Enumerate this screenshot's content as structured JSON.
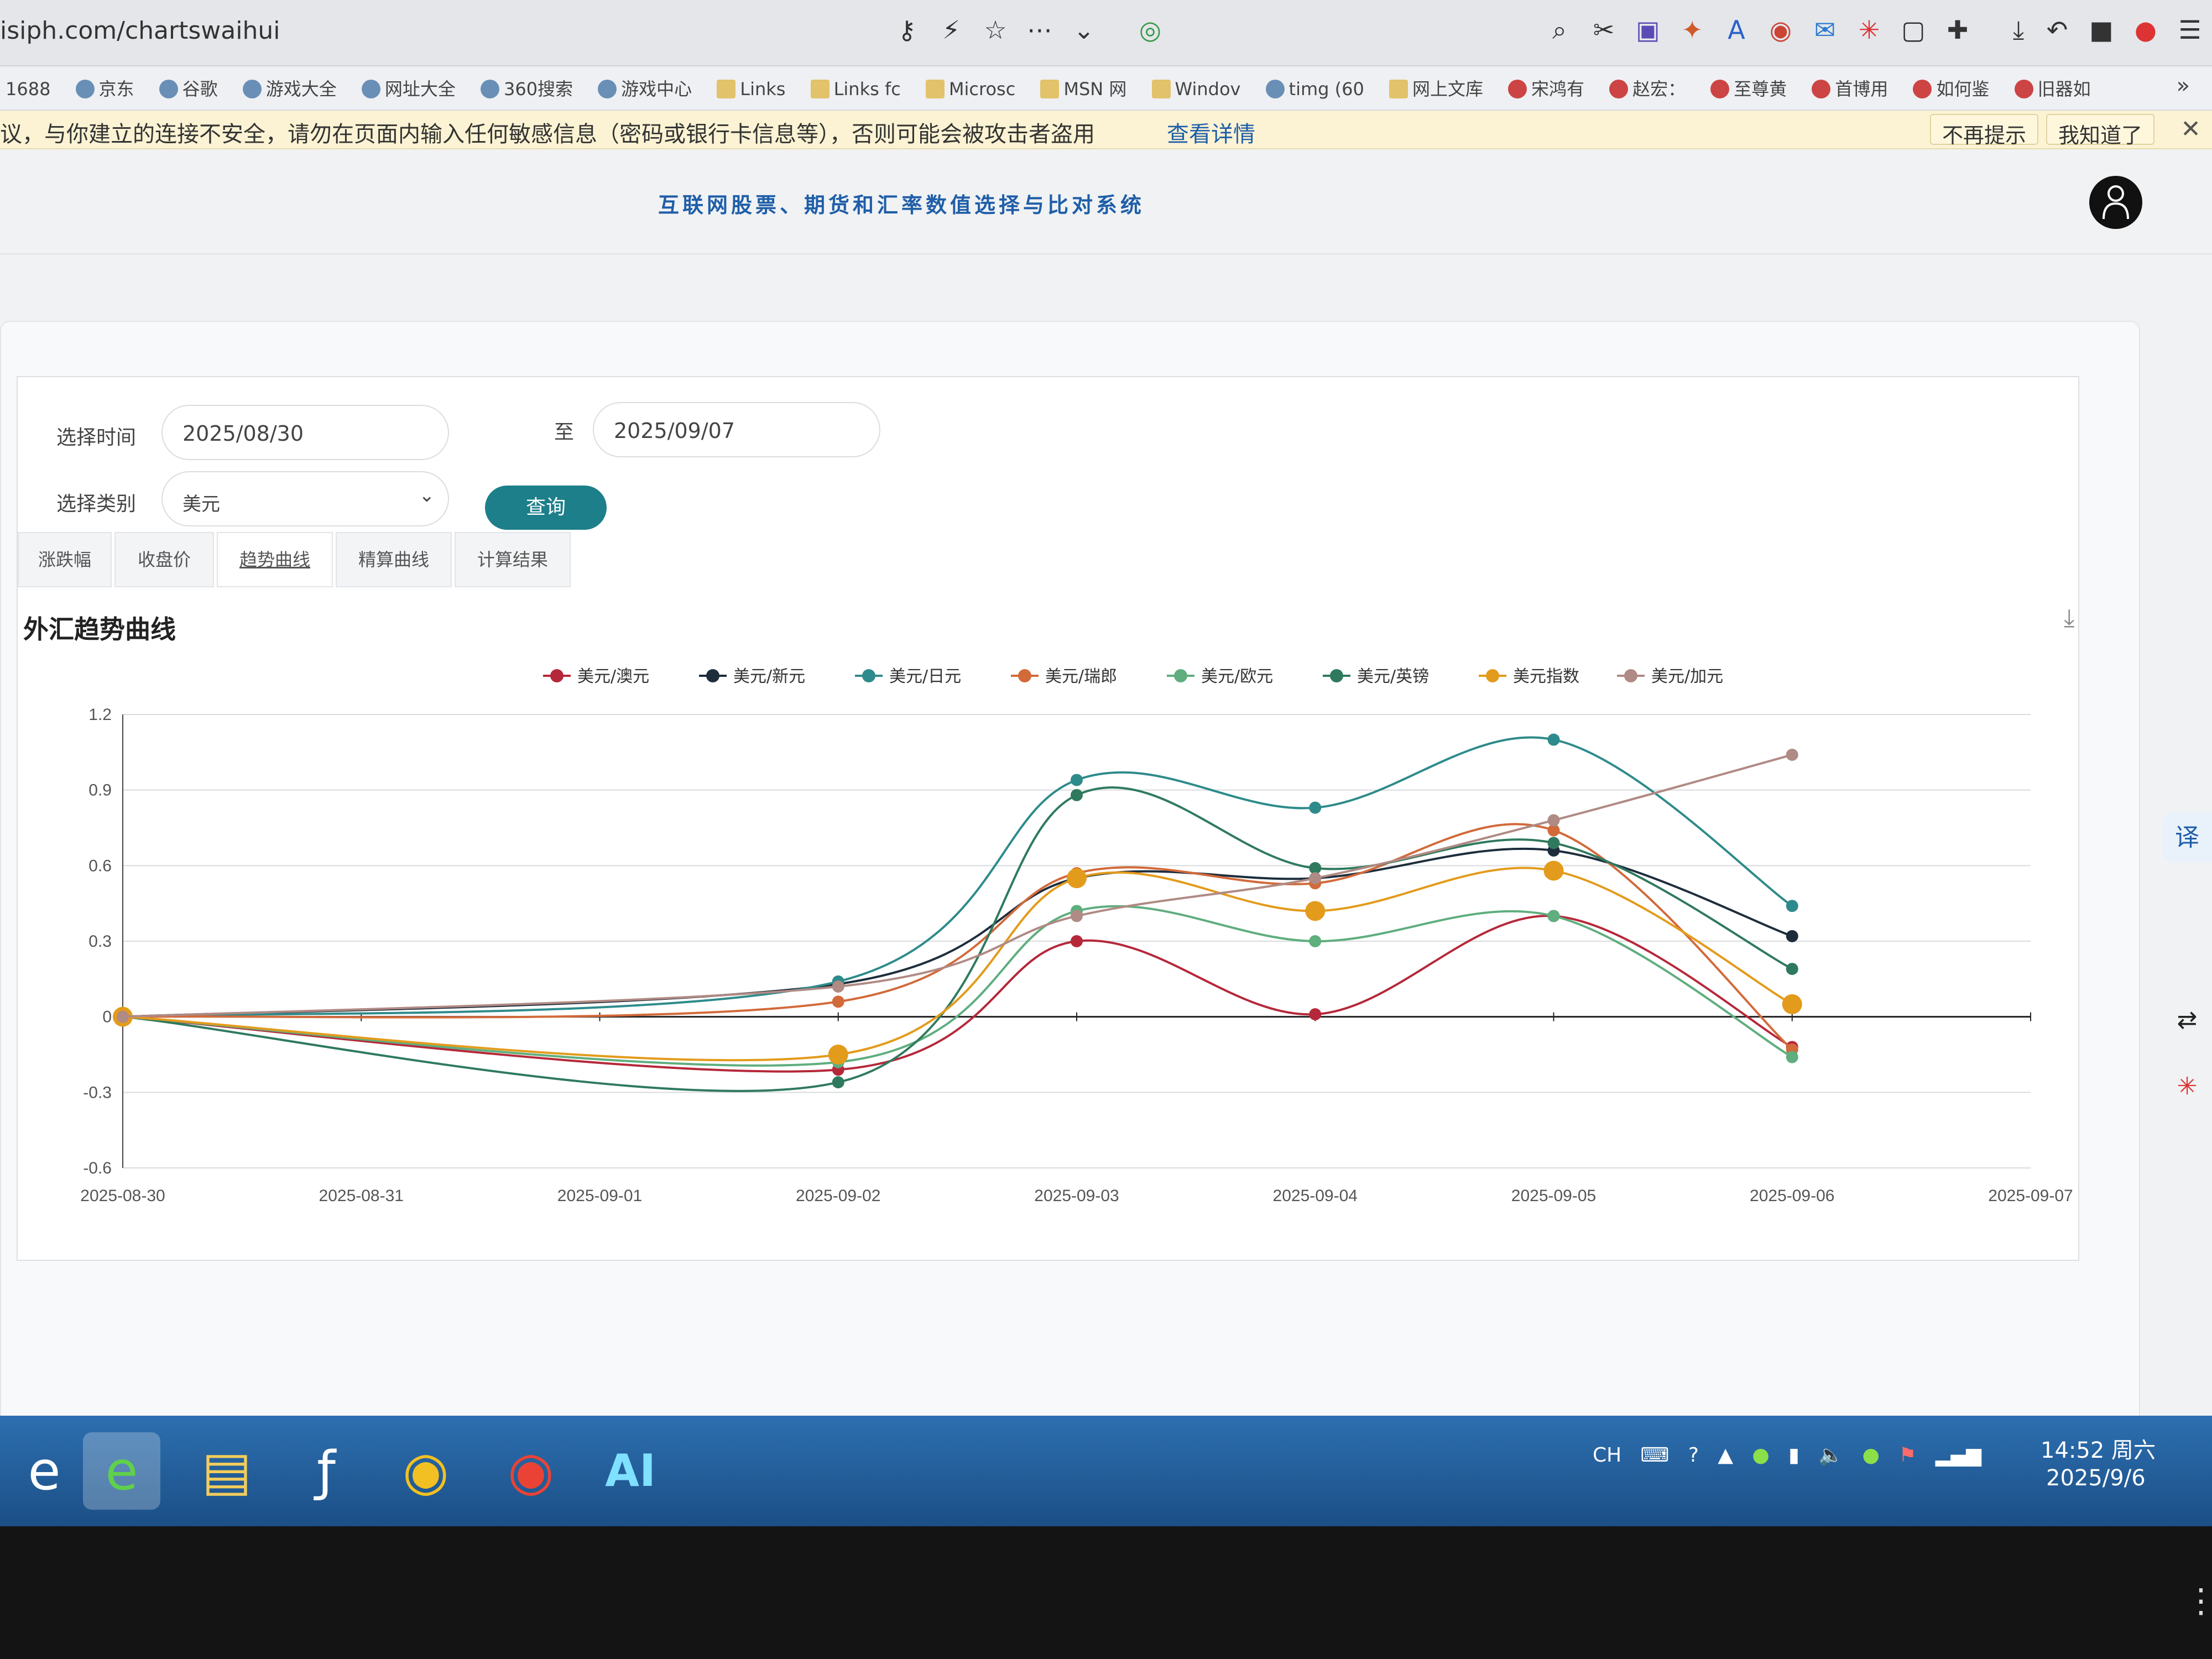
{
  "browser": {
    "url": "isiph.com/chartswaihui",
    "toolbar_icons": [
      "key-icon",
      "lightning-icon",
      "star-icon",
      "more-icon",
      "chevron-down-icon",
      "extension-icon"
    ]
  },
  "bookmarks": [
    {
      "label": "1688",
      "icon": "none"
    },
    {
      "label": "京东",
      "icon": "globe"
    },
    {
      "label": "谷歌",
      "icon": "globe"
    },
    {
      "label": "游戏大全",
      "icon": "globe"
    },
    {
      "label": "网址大全",
      "icon": "globe"
    },
    {
      "label": "360搜索",
      "icon": "globe"
    },
    {
      "label": "游戏中心",
      "icon": "globe"
    },
    {
      "label": "Links",
      "icon": "folder"
    },
    {
      "label": "Links fc",
      "icon": "folder"
    },
    {
      "label": "Microsc",
      "icon": "folder"
    },
    {
      "label": "MSN 网",
      "icon": "folder"
    },
    {
      "label": "Windov",
      "icon": "folder"
    },
    {
      "label": "timg (60",
      "icon": "globe"
    },
    {
      "label": "网上文库",
      "icon": "folder"
    },
    {
      "label": "宋鸿有",
      "icon": "weibo"
    },
    {
      "label": "赵宏：",
      "icon": "weibo"
    },
    {
      "label": "至尊黄",
      "icon": "weibo"
    },
    {
      "label": "首博用",
      "icon": "weibo"
    },
    {
      "label": "如何鉴",
      "icon": "weibo"
    },
    {
      "label": "旧器如",
      "icon": "weibo"
    }
  ],
  "warning": {
    "text": "议，与你建立的连接不安全，请勿在页面内输入任何敏感信息（密码或银行卡信息等），否则可能会被攻击者盗用",
    "link": "查看详情",
    "dismiss": "不再提示",
    "ok": "我知道了"
  },
  "site": {
    "title": "互联网股票、期货和汇率数值选择与比对系统"
  },
  "form": {
    "time_label": "选择时间",
    "date_from": "2025/08/30",
    "to_label": "至",
    "date_to": "2025/09/07",
    "category_label": "选择类别",
    "category_value": "美元",
    "query_button": "查询"
  },
  "tabs": [
    "涨跌幅",
    "收盘价",
    "趋势曲线",
    "精算曲线",
    "计算结果"
  ],
  "chart_data": {
    "type": "line",
    "title": "外汇趋势曲线",
    "categories": [
      "2025-08-30",
      "2025-08-31",
      "2025-09-01",
      "2025-09-02",
      "2025-09-03",
      "2025-09-04",
      "2025-09-05",
      "2025-09-06",
      "2025-09-07"
    ],
    "ylim": [
      -0.6,
      1.2
    ],
    "yticks": [
      "1.2",
      "0.9",
      "0.6",
      "0.3",
      "0",
      "-0.3",
      "-0.6"
    ],
    "series": [
      {
        "name": "美元/澳元",
        "color": "#b5283a",
        "values": [
          0,
          null,
          null,
          -0.21,
          0.3,
          0.01,
          0.4,
          -0.12,
          null
        ]
      },
      {
        "name": "美元/新元",
        "color": "#1d2d3c",
        "values": [
          0,
          null,
          null,
          0.13,
          0.55,
          0.55,
          0.66,
          0.32,
          null
        ]
      },
      {
        "name": "美元/日元",
        "color": "#2e8b8b",
        "values": [
          0,
          null,
          null,
          0.14,
          0.94,
          0.83,
          1.1,
          0.44,
          null
        ]
      },
      {
        "name": "美元/瑞郎",
        "color": "#d26a3a",
        "values": [
          0,
          null,
          null,
          0.06,
          0.57,
          0.53,
          0.74,
          -0.13,
          null
        ]
      },
      {
        "name": "美元/欧元",
        "color": "#5fae7e",
        "values": [
          0,
          null,
          null,
          -0.18,
          0.42,
          0.3,
          0.4,
          -0.16,
          null
        ]
      },
      {
        "name": "美元/英镑",
        "color": "#2f7a5e",
        "values": [
          0,
          null,
          null,
          -0.26,
          0.88,
          0.59,
          0.69,
          0.19,
          null
        ]
      },
      {
        "name": "美元指数",
        "color": "#e39b1c",
        "values": [
          0,
          null,
          null,
          -0.15,
          0.55,
          0.42,
          0.58,
          0.05,
          null
        ]
      },
      {
        "name": "美元/加元",
        "color": "#b08a84",
        "values": [
          0,
          null,
          null,
          0.12,
          0.4,
          0.55,
          0.78,
          1.04,
          null
        ]
      }
    ]
  },
  "taskbar": {
    "apps": [
      "ie-icon",
      "ie-edge-icon",
      "file-explorer-icon",
      "flash-icon",
      "chrome-icon",
      "chrome-icon-2",
      "ai-icon"
    ],
    "tray_text": "CH",
    "time": "14:52 周六",
    "date": "2025/9/6"
  }
}
